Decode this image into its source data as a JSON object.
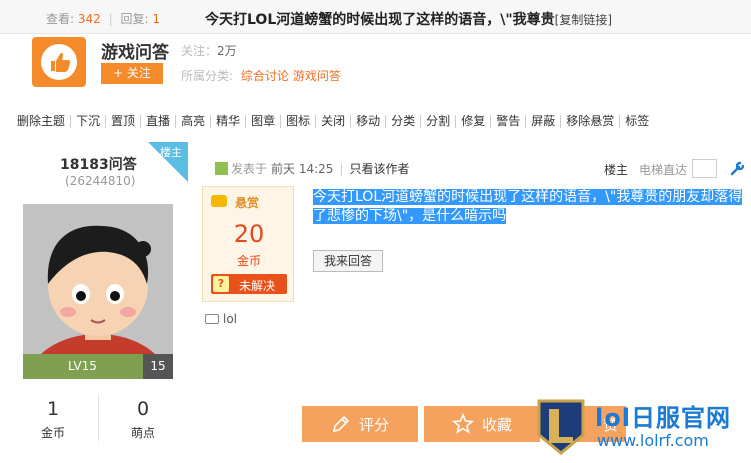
{
  "topbar": {
    "views_label": "查看:",
    "views": "342",
    "replies_label": "回复:",
    "replies": "1",
    "title": "今天打LOL河道螃蟹的时候出现了这样的语音，\\\"我尊贵",
    "copy_link": "[复制链接]"
  },
  "forum": {
    "name": "游戏问答",
    "followers_label": "关注：",
    "followers": "2万",
    "follow_button": "+ 关注",
    "category_label": "所属分类:",
    "categories": [
      "综合讨论",
      "游戏问答"
    ]
  },
  "admin_tools": [
    "删除主题",
    "下沉",
    "置顶",
    "直播",
    "高亮",
    "精华",
    "图章",
    "图标",
    "关闭",
    "移动",
    "分类",
    "分割",
    "修复",
    "警告",
    "屏蔽",
    "移除悬赏",
    "标签"
  ],
  "author": {
    "name": "18183问答",
    "id": "(26244810)",
    "owner_tag": "楼主",
    "level": "LV15",
    "level_num": "15",
    "coins": "1",
    "coins_label": "金币",
    "cute_points": "0",
    "cute_points_label": "萌点"
  },
  "post": {
    "posted_label": "发表于",
    "time": "前天 14:25",
    "only_author": "只看该作者",
    "floor_label": "楼主",
    "jump_label": "电梯直达",
    "text": "今天打LOL河道螃蟹的时候出现了这样的语音，\\\"我尊贵的朋友却落得了悲惨的下场\\\"，是什么暗示吗",
    "reply_button": "我来回答",
    "tag": "lol"
  },
  "bounty": {
    "title": "悬赏",
    "amount": "20",
    "unit": "金币",
    "status": "未解决",
    "status_icon": "?"
  },
  "actions": {
    "rate": "评分",
    "favorite": "收藏",
    "partial": "赞"
  },
  "watermark": {
    "name": "lol日服官网",
    "url": "www.lolrf.com"
  },
  "colors": {
    "accent": "#f58a2a",
    "link": "#f26c22",
    "level_bar": "#7fa050",
    "selection": "#3399ff",
    "watermark": "#1a7ad4"
  }
}
